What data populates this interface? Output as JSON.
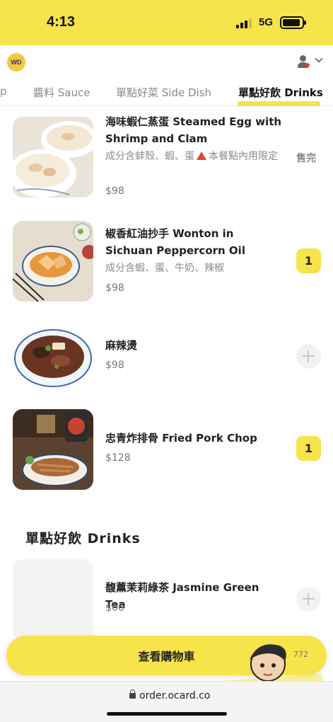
{
  "status_bar": {
    "time": "4:13",
    "network": "5G"
  },
  "header": {
    "logo_text": "WD",
    "user_icon": "user-icon",
    "menu_icon": "chevron-down-icon"
  },
  "tabs": [
    {
      "label": "p"
    },
    {
      "label": "醬料 Sauce"
    },
    {
      "label": "單點好菜 Side Dish"
    },
    {
      "label": "單點好飲 Drinks",
      "active": true
    }
  ],
  "items": [
    {
      "name": "海味蝦仁蒸蛋 Steamed Egg with Shrimp and Clam",
      "desc_before": "成分含蚌殼、蝦、蛋",
      "desc_after": "本餐點內用限定",
      "price": "$98",
      "status": "售完"
    },
    {
      "name": "椒香紅油抄手 Wonton in Sichuan Peppercorn Oil",
      "desc": "成分含蝦、蛋、牛奶、辣椒",
      "price": "$98",
      "qty": "1"
    },
    {
      "name": "麻辣燙",
      "price": "$98"
    },
    {
      "name": "忠青炸排骨 Fried Pork Chop",
      "price": "$128",
      "qty": "1"
    }
  ],
  "drinks_section": {
    "title": "單點好飲 Drinks",
    "items": [
      {
        "name": "馥薰茉莉綠茶 Jasmine Green Tea",
        "price": "$60"
      }
    ]
  },
  "cart": {
    "label": "查看購物車",
    "total": "772"
  },
  "browser": {
    "url": "order.ocard.co"
  },
  "colors": {
    "accent": "#f7e34a",
    "warning": "#e0443a",
    "muted": "#888888"
  }
}
